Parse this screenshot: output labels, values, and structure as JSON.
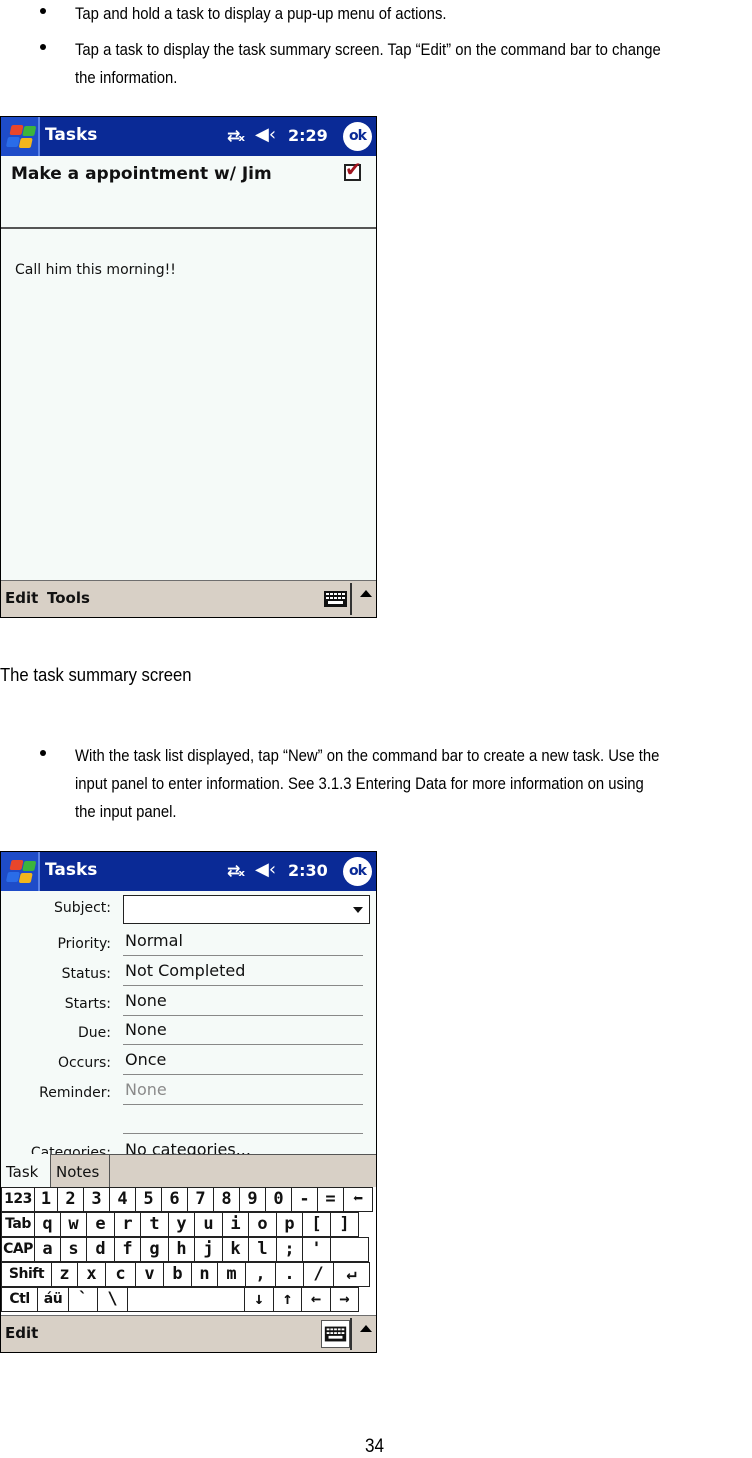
{
  "bullets_top": [
    {
      "lines": [
        "Tap and hold a task to display a pup-up menu of actions."
      ]
    },
    {
      "lines": [
        "Tap a task to display the task summary screen. Tap “Edit” on the command bar to change",
        "the information."
      ]
    }
  ],
  "screen1": {
    "title": "Tasks",
    "clock": "2:29",
    "ok_label": "ok",
    "connectivity_icon": "⇄ₓ",
    "volume_icon": "◀‹",
    "task_title": "Make a appointment w/ Jim",
    "task_completed": true,
    "check_glyph": "✔",
    "notes": "Call him this morning!!",
    "cmdbar": [
      "Edit",
      "Tools"
    ]
  },
  "caption": "The task summary screen",
  "bullets_bottom": [
    {
      "lines": [
        "With the task list displayed, tap “New” on the command bar to create a new task. Use the",
        "input panel to enter information. See 3.1.3 Entering Data for more information on using",
        "the input panel."
      ]
    }
  ],
  "screen2": {
    "title": "Tasks",
    "clock": "2:30",
    "ok_label": "ok",
    "connectivity_icon": "⇄ₓ",
    "volume_icon": "◀‹",
    "form": {
      "subject_label": "Subject:",
      "subject_value": "",
      "fields": [
        {
          "label": "Priority:",
          "value": "Normal",
          "dim": false
        },
        {
          "label": "Status:",
          "value": "Not Completed",
          "dim": false
        },
        {
          "label": "Starts:",
          "value": "None",
          "dim": false
        },
        {
          "label": "Due:",
          "value": "None",
          "dim": false
        },
        {
          "label": "Occurs:",
          "value": "Once",
          "dim": false
        },
        {
          "label": "Reminder:",
          "value": "None",
          "dim": true
        },
        {
          "label": "",
          "value": "",
          "dim": false
        },
        {
          "label": "Categories:",
          "value": "No categories...",
          "dim": false
        }
      ]
    },
    "tabs": [
      "Task",
      "Notes"
    ],
    "keyboard": {
      "rows": [
        [
          "123",
          "1",
          "2",
          "3",
          "4",
          "5",
          "6",
          "7",
          "8",
          "9",
          "0",
          "-",
          "=",
          "⬅"
        ],
        [
          "Tab",
          "q",
          "w",
          "e",
          "r",
          "t",
          "y",
          "u",
          "i",
          "o",
          "p",
          "[",
          "]"
        ],
        [
          "CAP",
          "a",
          "s",
          "d",
          "f",
          "g",
          "h",
          "j",
          "k",
          "l",
          ";",
          "'",
          ""
        ],
        [
          "Shift",
          "z",
          "x",
          "c",
          "v",
          "b",
          "n",
          "m",
          ",",
          ".",
          "/",
          "↵"
        ],
        [
          "Ctl",
          "áü",
          "`",
          "\\",
          " ",
          "↓",
          "↑",
          "←",
          "→"
        ]
      ]
    },
    "cmdbar": [
      "Edit"
    ]
  },
  "page_number": "34"
}
